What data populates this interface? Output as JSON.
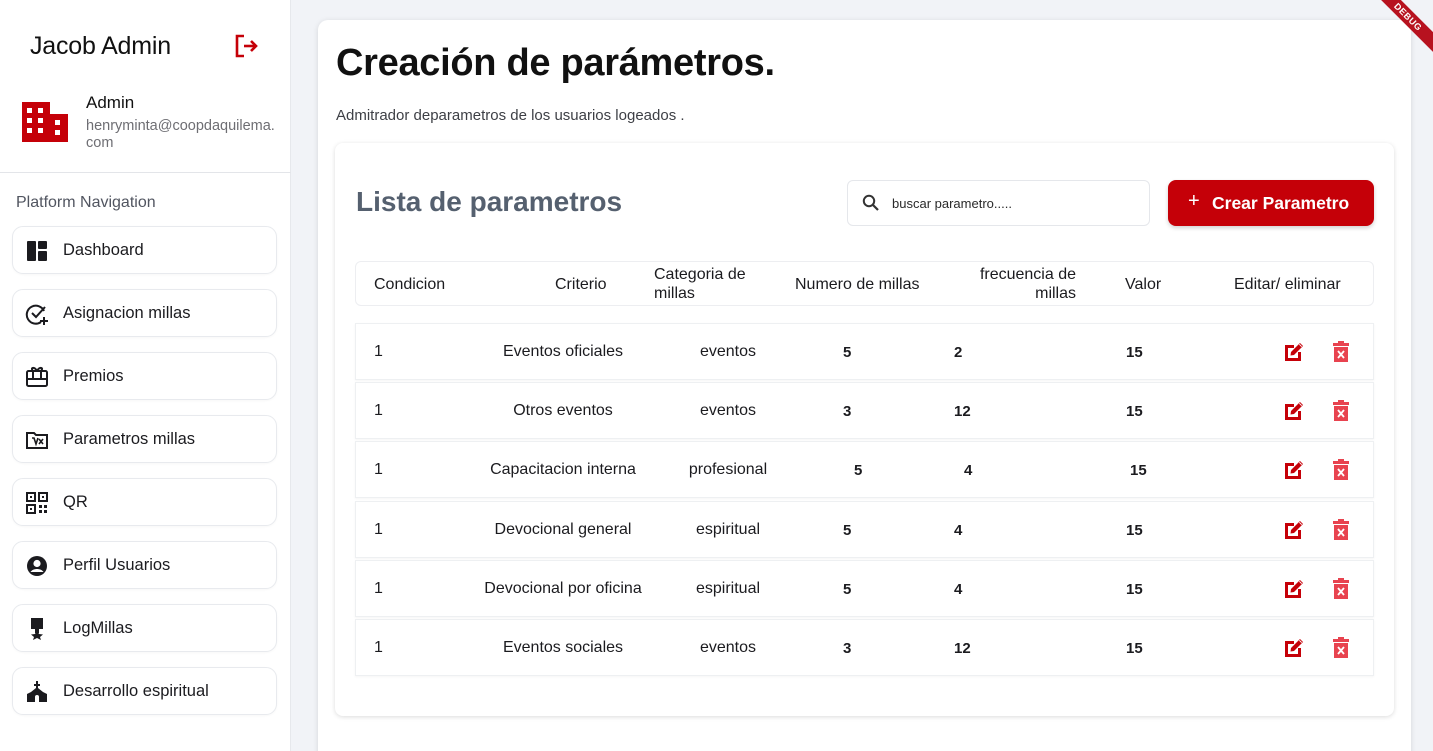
{
  "sidebar": {
    "title": "Jacob Admin",
    "user_role": "Admin",
    "user_email": "henryminta@coopdaquilema.com",
    "nav_title": "Platform Navigation",
    "items": [
      {
        "label": "Dashboard",
        "icon": "dashboard-icon"
      },
      {
        "label": "Asignacion millas",
        "icon": "add-task-icon"
      },
      {
        "label": "Premios",
        "icon": "gift-card-icon"
      },
      {
        "label": "Parametros millas",
        "icon": "folder-formula-icon"
      },
      {
        "label": "QR",
        "icon": "qr-code-icon"
      },
      {
        "label": "Perfil Usuarios",
        "icon": "account-circle-icon"
      },
      {
        "label": "LogMillas",
        "icon": "award-ribbon-icon"
      },
      {
        "label": "Desarrollo espiritual",
        "icon": "church-icon"
      }
    ]
  },
  "main": {
    "title": "Creación de parámetros.",
    "subtitle": "Admitrador deparametros de los usuarios logeados ."
  },
  "list": {
    "title": "Lista de parametros",
    "search_placeholder": "buscar parametro.....",
    "create_label": "Crear Parametro",
    "create_symbol": "+",
    "columns": [
      "Condicion",
      "Criterio",
      "Categoria de millas",
      "Numero de millas",
      "frecuencia de millas",
      "Valor",
      "Editar/ eliminar"
    ],
    "rows": [
      {
        "condicion": "1",
        "criterio": "Eventos oficiales",
        "categoria": "eventos",
        "numero": "5",
        "frecuencia": "2",
        "valor": "15"
      },
      {
        "condicion": "1",
        "criterio": "Otros eventos",
        "categoria": "eventos",
        "numero": "3",
        "frecuencia": "12",
        "valor": "15"
      },
      {
        "condicion": "1",
        "criterio": "Capacitacion interna",
        "categoria": "profesional",
        "numero": "5",
        "frecuencia": "4",
        "valor": "15"
      },
      {
        "condicion": "1",
        "criterio": "Devocional general",
        "categoria": "espiritual",
        "numero": "5",
        "frecuencia": "4",
        "valor": "15"
      },
      {
        "condicion": "1",
        "criterio": "Devocional por oficina",
        "categoria": "espiritual",
        "numero": "5",
        "frecuencia": "4",
        "valor": "15"
      },
      {
        "condicion": "1",
        "criterio": "Eventos sociales",
        "categoria": "eventos",
        "numero": "3",
        "frecuencia": "12",
        "valor": "15"
      }
    ]
  },
  "debug_label": "DEBUG",
  "colors": {
    "accent": "#c50008",
    "delete": "#e8434f",
    "list_title": "#55606f"
  }
}
